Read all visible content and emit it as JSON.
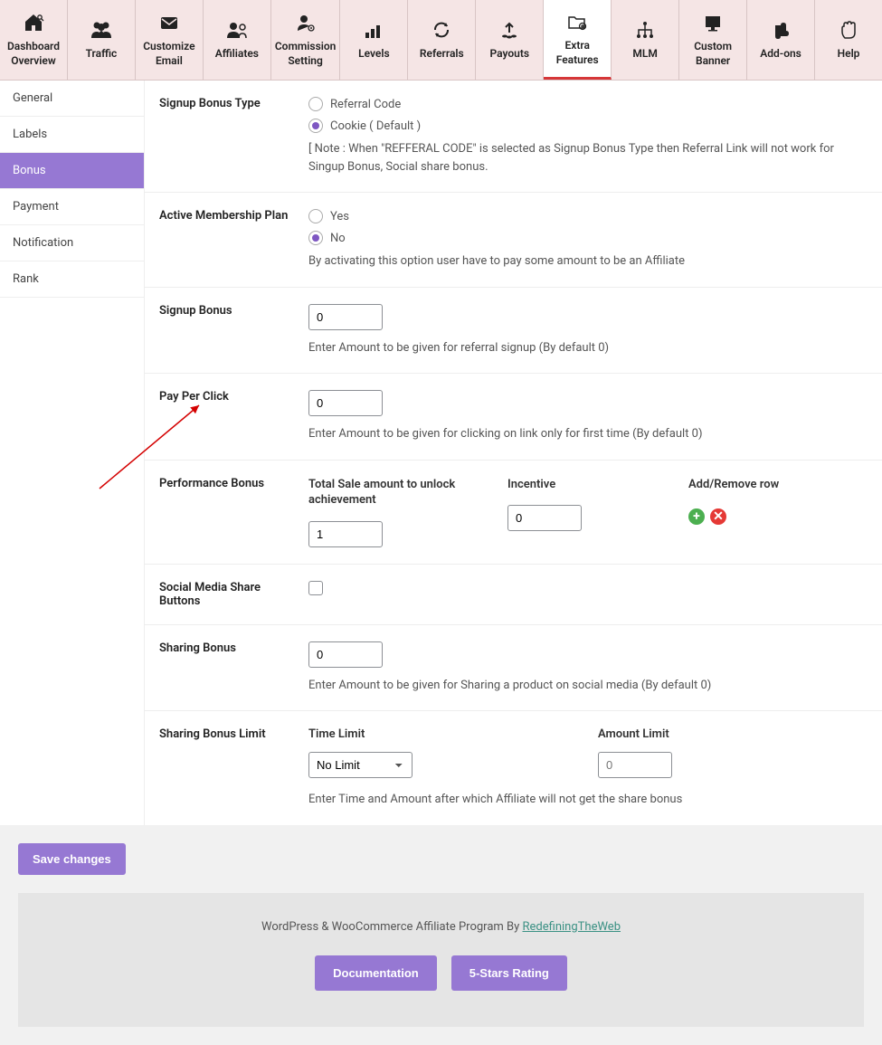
{
  "topnav": [
    {
      "label": "Dashboard Overview",
      "icon": "home"
    },
    {
      "label": "Traffic",
      "icon": "users"
    },
    {
      "label": "Customize Email",
      "icon": "mail"
    },
    {
      "label": "Affiliates",
      "icon": "user-pair"
    },
    {
      "label": "Commission Setting",
      "icon": "user-gear"
    },
    {
      "label": "Levels",
      "icon": "bars"
    },
    {
      "label": "Referrals",
      "icon": "refresh"
    },
    {
      "label": "Payouts",
      "icon": "payout"
    },
    {
      "label": "Extra Features",
      "icon": "folder-plus",
      "active": true
    },
    {
      "label": "MLM",
      "icon": "hierarchy"
    },
    {
      "label": "Custom Banner",
      "icon": "monitor"
    },
    {
      "label": "Add-ons",
      "icon": "puzzle"
    },
    {
      "label": "Help",
      "icon": "hand"
    }
  ],
  "sidebar": [
    {
      "label": "General"
    },
    {
      "label": "Labels"
    },
    {
      "label": "Bonus",
      "active": true
    },
    {
      "label": "Payment"
    },
    {
      "label": "Notification"
    },
    {
      "label": "Rank"
    }
  ],
  "fields": {
    "signup_bonus_type": {
      "label": "Signup Bonus Type",
      "opt1": "Referral Code",
      "opt2": "Cookie ( Default )",
      "note": "[ Note : When \"REFFERAL CODE\" is selected as Signup Bonus Type then Referral Link will not work for Singup Bonus, Social share bonus."
    },
    "active_membership": {
      "label": "Active Membership Plan",
      "opt1": "Yes",
      "opt2": "No",
      "note": "By activating this option user have to pay some amount to be an Affiliate"
    },
    "signup_bonus": {
      "label": "Signup Bonus",
      "value": "0",
      "note": "Enter Amount to be given for referral signup (By default 0)"
    },
    "pay_per_click": {
      "label": "Pay Per Click",
      "value": "0",
      "note": "Enter Amount to be given for clicking on link only for first time (By default 0)"
    },
    "performance_bonus": {
      "label": "Performance Bonus",
      "col1": "Total Sale amount to unlock achievement",
      "col2": "Incentive",
      "col3": "Add/Remove row",
      "val1": "1",
      "val2": "0"
    },
    "social_share": {
      "label": "Social Media Share Buttons"
    },
    "sharing_bonus": {
      "label": "Sharing Bonus",
      "value": "0",
      "note": "Enter Amount to be given for Sharing a product on social media (By default 0)"
    },
    "sharing_limit": {
      "label": "Sharing Bonus Limit",
      "col1": "Time Limit",
      "col2": "Amount Limit",
      "time_value": "No Limit",
      "amount_placeholder": "0",
      "note": "Enter Time and Amount after which Affiliate will not get the share bonus"
    }
  },
  "save_label": "Save changes",
  "footer": {
    "text_prefix": "WordPress & WooCommerce Affiliate Program By ",
    "link": "RedefiningTheWeb",
    "btn1": "Documentation",
    "btn2": "5-Stars Rating"
  }
}
